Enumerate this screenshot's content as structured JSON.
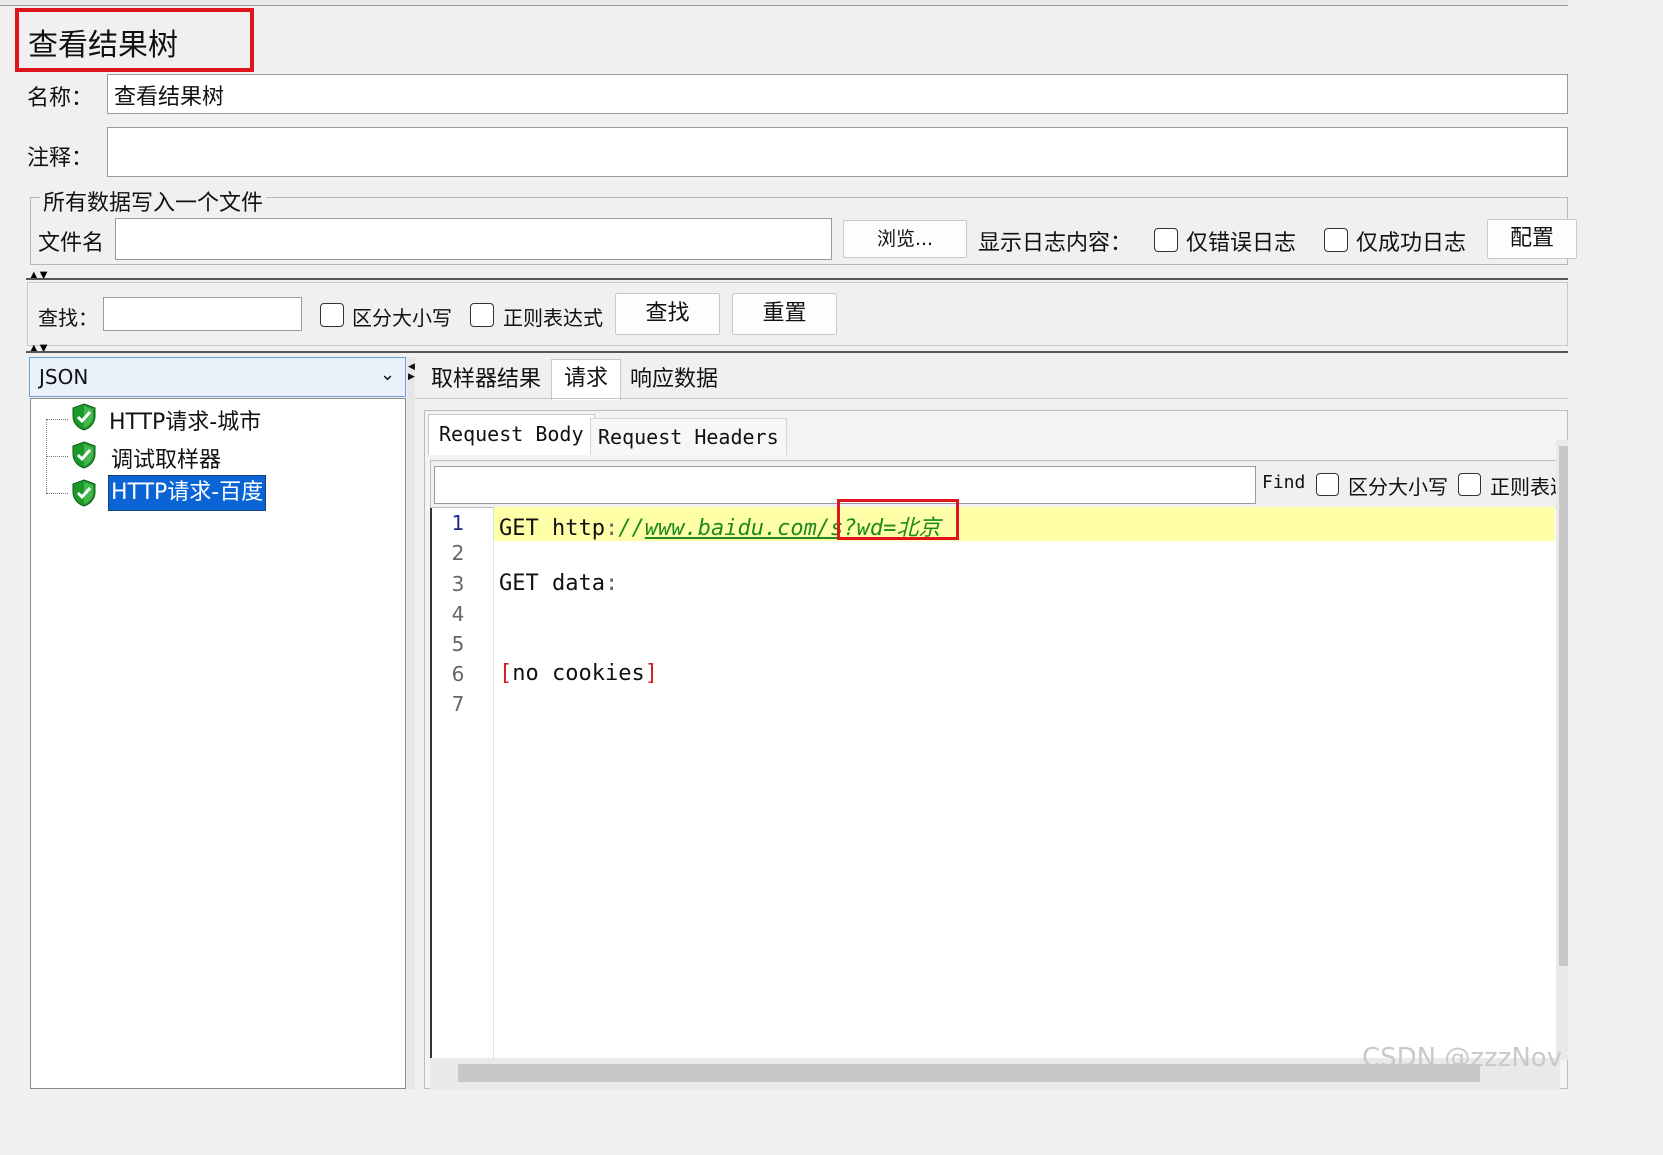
{
  "window": {
    "title": "查看结果树"
  },
  "form": {
    "name_label": "名称：",
    "name_value": "查看结果树",
    "comment_label": "注释：",
    "comment_value": ""
  },
  "file_group": {
    "legend": "所有数据写入一个文件",
    "filename_label": "文件名",
    "filename_value": "",
    "browse_button": "浏览...",
    "log_label": "显示日志内容：",
    "errors_only": "仅错误日志",
    "success_only": "仅成功日志",
    "config_button": "配置"
  },
  "search": {
    "label": "查找：",
    "value": "",
    "case_label": "区分大小写",
    "regex_label": "正则表达式",
    "find_button": "查找",
    "reset_button": "重置"
  },
  "renderer": {
    "selected": "JSON"
  },
  "tree": {
    "items": [
      {
        "label": "HTTP请求-城市",
        "status": "success"
      },
      {
        "label": "调试取样器",
        "status": "success"
      },
      {
        "label": "HTTP请求-百度",
        "status": "success",
        "selected": true
      }
    ]
  },
  "result_tabs": [
    "取样器结果",
    "请求",
    "响应数据"
  ],
  "result_tabs_active": "请求",
  "sub_tabs": [
    "Request Body",
    "Request Headers"
  ],
  "sub_tabs_active": "Request Body",
  "editor_search": {
    "value": "",
    "find_label": "Find",
    "case_label": "区分大小写",
    "regex_label": "正则表达"
  },
  "editor": {
    "line_numbers": [
      "1",
      "2",
      "3",
      "4",
      "5",
      "6",
      "7"
    ],
    "line1": {
      "method": "GET",
      "scheme": "http",
      "colon": ":",
      "slashes": "//",
      "url_path": "www.baidu.com/s",
      "query_key": "?wd",
      "eq": "=",
      "query_value": "北京"
    },
    "line3": {
      "text": "GET data",
      "colon": ":"
    },
    "line6": {
      "open": "[",
      "text": "no cookies",
      "close": "]"
    }
  },
  "watermark": "CSDN @zzzNov",
  "colors": {
    "highlight_box": "#e0141e",
    "tree_selected": "#0a64d6",
    "current_line": "#ffffa8",
    "url_green": "#1f8a1f",
    "bracket_red": "#d02020"
  },
  "icons": {
    "tree_status": "green-shield-check-icon",
    "combo_arrow": "chevron-down-icon"
  }
}
